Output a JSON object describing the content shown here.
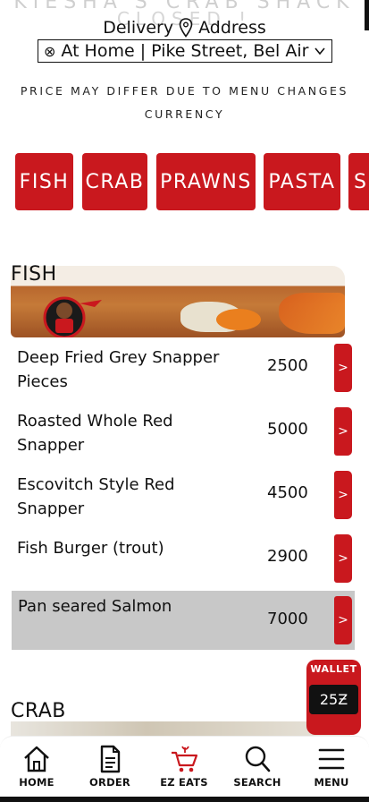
{
  "header": {
    "store_name": "KIESHA'S CRAB SHACK",
    "status": "CLOSED !",
    "delivery_label": "Delivery",
    "address_label": "Address",
    "address_value": "At Home | Pike Street, Bel Air F"
  },
  "notices": {
    "line1": "PRICE MAY DIFFER DUE TO MENU CHANGES",
    "line2": "CURRENCY"
  },
  "categories": [
    "FISH",
    "CRAB",
    "PRAWNS",
    "PASTA",
    "S"
  ],
  "sections": {
    "fish": {
      "title": "FISH",
      "items": [
        {
          "name": "Deep Fried Grey Snapper Pieces",
          "price": "2500"
        },
        {
          "name": "Roasted Whole Red Snapper",
          "price": "5000"
        },
        {
          "name": "Escovitch Style Red Snapper",
          "price": "4500"
        },
        {
          "name": "Fish Burger (trout)",
          "price": "2900"
        },
        {
          "name": "Pan seared Salmon",
          "price": "7000"
        }
      ]
    },
    "crab": {
      "title": "CRAB"
    }
  },
  "item_action_glyph": ">",
  "wallet": {
    "label": "WALLET",
    "amount": "25Ƶ"
  },
  "nav": [
    {
      "label": "HOME",
      "icon": "home-icon"
    },
    {
      "label": "ORDER",
      "icon": "document-icon"
    },
    {
      "label": "EZ EATS",
      "icon": "cart-icon"
    },
    {
      "label": "SEARCH",
      "icon": "search-icon"
    },
    {
      "label": "MENU",
      "icon": "hamburger-icon"
    }
  ],
  "colors": {
    "accent": "#c9181e",
    "selected_row": "#c8c8c8"
  }
}
